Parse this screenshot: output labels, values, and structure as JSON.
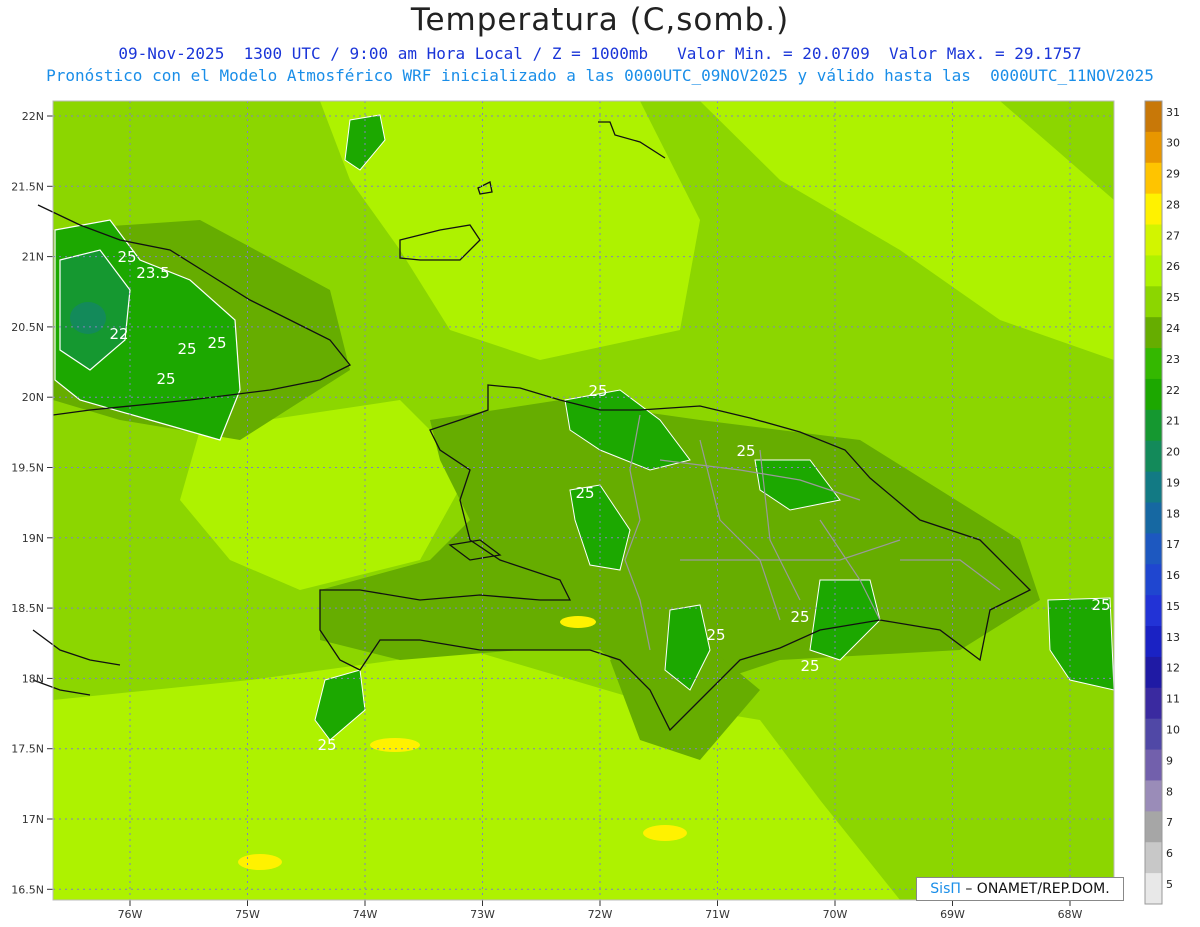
{
  "header": {
    "title": "Temperatura (C,somb.)",
    "line1": "09-Nov-2025  1300 UTC / 9:00 am Hora Local / Z = 1000mb   Valor Min. = 20.0709  Valor Max. = 29.1757",
    "line2": "Pronóstico con el Modelo Atmosférico WRF inicializado a las 0000UTC_09NOV2025 y válido hasta las  0000UTC_11NOV2025"
  },
  "map": {
    "lat_ticks": [
      "22N",
      "21.5N",
      "21N",
      "20.5N",
      "20N",
      "19.5N",
      "19N",
      "18.5N",
      "18N",
      "17.5N",
      "17N",
      "16.5N"
    ],
    "lon_ticks": [
      "76W",
      "75W",
      "74W",
      "73W",
      "72W",
      "71W",
      "70W",
      "69W",
      "68W"
    ],
    "contour_labels": [
      "25",
      "23.5",
      "22",
      "25",
      "25",
      "25",
      "25",
      "25",
      "25",
      "25",
      "25",
      "25",
      "25",
      "25"
    ]
  },
  "colorbar": {
    "labels": [
      "31",
      "30",
      "29",
      "28",
      "27",
      "26",
      "25",
      "24",
      "23",
      "22",
      "21",
      "20",
      "19",
      "18",
      "17",
      "16",
      "15",
      "13",
      "12",
      "11",
      "10",
      "9",
      "8",
      "7",
      "6",
      "5"
    ],
    "colors": [
      "#c87808",
      "#e89600",
      "#ffc400",
      "#fff200",
      "#d2f500",
      "#aef200",
      "#8cd600",
      "#66ad00",
      "#34b800",
      "#1ca800",
      "#159830",
      "#138a5a",
      "#127a84",
      "#1668a2",
      "#1d58c0",
      "#1f46d0",
      "#2233d6",
      "#1a22c4",
      "#1f1aa4",
      "#3a2aa0",
      "#5048a6",
      "#7260ac",
      "#9a8cb8",
      "#a6a6a6",
      "#c8c8c8",
      "#e8e8e8"
    ]
  },
  "credit": {
    "pi": "SisΠ",
    "text": " – ONAMET/REP.DOM."
  }
}
